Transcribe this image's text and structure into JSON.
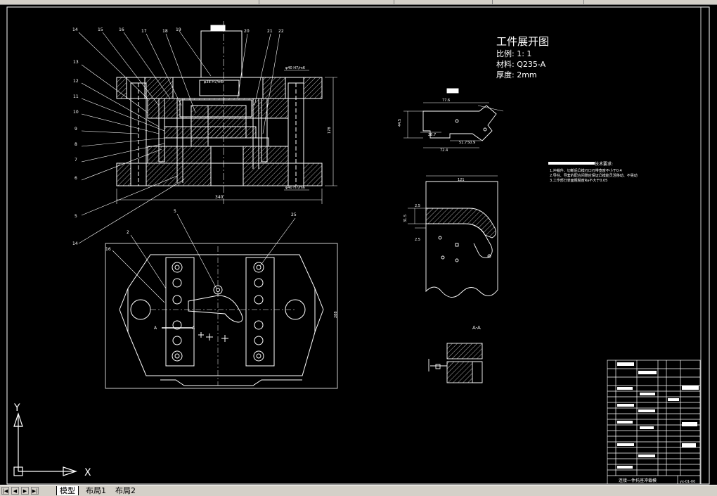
{
  "workpiece": {
    "title": "工件展开图",
    "scale": "比例: 1: 1",
    "material": "材料: Q235-A",
    "thickness": "厚度: 2mm"
  },
  "tech_requirements": {
    "heading": "技术要求:",
    "items": [
      "1.冲裁件、切断后凸模刃口刃带宽度不小于0.4",
      "2.导柱、导套的配合间隙应保证凸模能灵活移动、不晃动",
      "3.工作部分表面粗糙度Ra不大于0.05"
    ]
  },
  "section_label": "A-A",
  "callouts": {
    "top": [
      "14",
      "15",
      "16",
      "17",
      "18",
      "19",
      "20",
      "21",
      "22"
    ],
    "left": [
      "13",
      "12",
      "11",
      "10",
      "9",
      "8",
      "7",
      "6",
      "5",
      "14"
    ],
    "plan": [
      "2",
      "16",
      "5",
      "25"
    ],
    "section_marks": [
      "A",
      "A"
    ]
  },
  "dimensions": {
    "base_width": "340",
    "total_height": "178",
    "plan_height": "288",
    "bush_top": "φ40 H7/m6",
    "bush_bottom": "φ40 H7/m6",
    "punch_fit": "φ38 H7/m6",
    "blank_w1": "77.6",
    "blank_w2": "72.4",
    "blank_w3": "51.7",
    "blank_w4": "28.7",
    "blank_w5": "50.9",
    "blank_h": "44.5",
    "view_width": "121",
    "dim_a": "2.5",
    "dim_b": "31.5",
    "dim_c": "2.5"
  },
  "title_block": {
    "name": "连接一件托座冲裁模",
    "code": "yx-01-00"
  },
  "ucs": {
    "x_label": "X",
    "y_label": "Y"
  },
  "tabs": {
    "model": "模型",
    "layout1": "布局1",
    "layout2": "布局2"
  },
  "colors": {
    "background": "#000000",
    "line": "#ffffff",
    "chrome": "#d4d0c8"
  }
}
